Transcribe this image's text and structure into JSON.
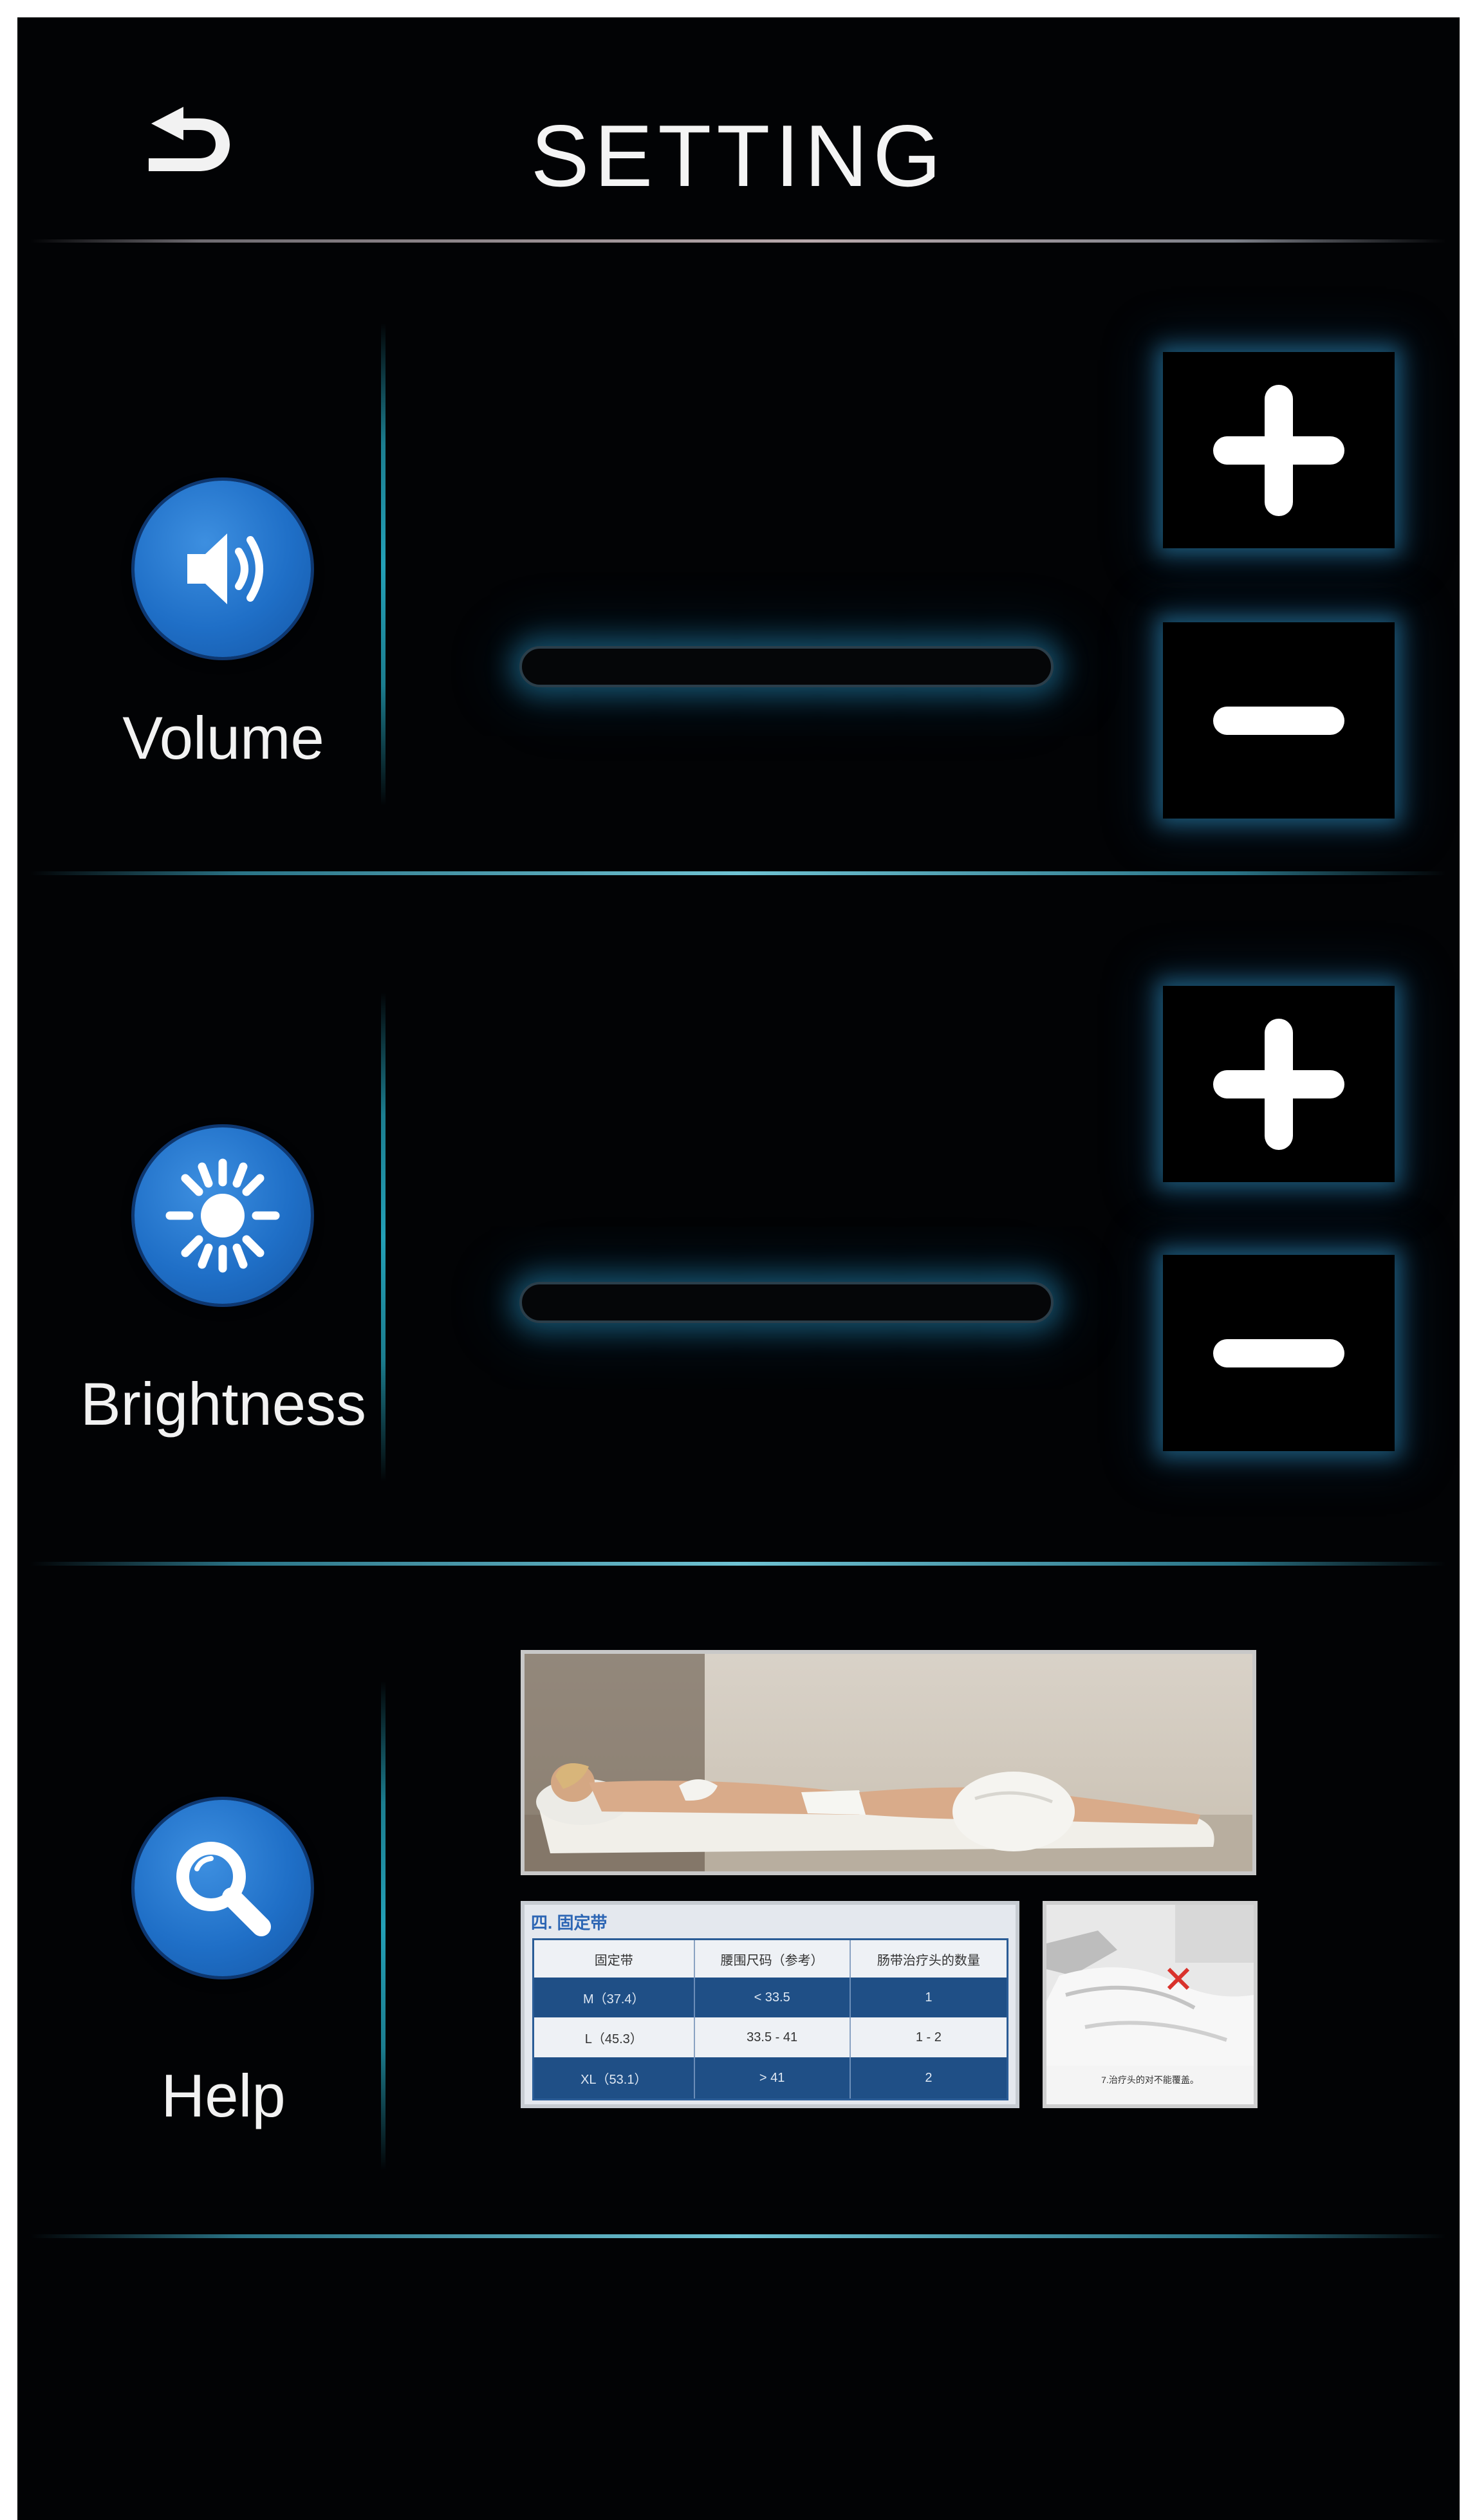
{
  "header": {
    "title": "SETTING",
    "back_icon": "back-arrow-icon"
  },
  "volume": {
    "label": "Volume",
    "icon": "speaker-icon",
    "level": 0
  },
  "brightness": {
    "label": "Brightness",
    "icon": "sun-icon",
    "level": 0
  },
  "help": {
    "label": "Help",
    "icon": "magnifier-icon",
    "thumbnails": {
      "table_title": "四. 固定带",
      "table_headers": [
        "固定带",
        "腰围尺码（参考）",
        "肠带治疗头的数量"
      ],
      "table_rows": [
        [
          "M（37.4）",
          "< 33.5",
          "1"
        ],
        [
          "L（45.3）",
          "33.5 - 41",
          "1 - 2"
        ],
        [
          "XL（53.1）",
          "> 41",
          "2"
        ]
      ],
      "caption": "7.治疗头的对不能覆盖。"
    }
  },
  "colors": {
    "background": "#020305",
    "accent_glow": "#2a9cd0",
    "icon_blue": "#1f6fc7"
  }
}
